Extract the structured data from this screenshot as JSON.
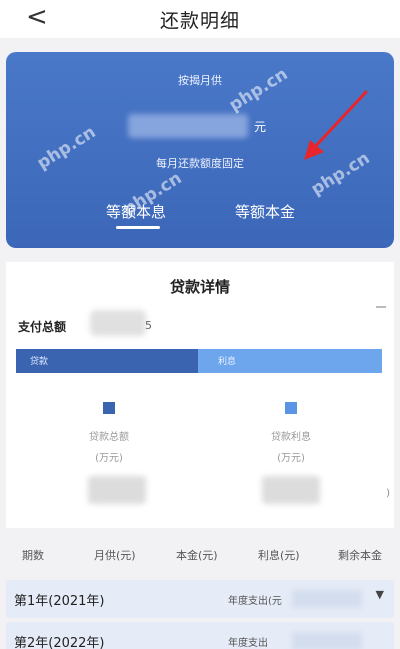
{
  "header": {
    "back_icon": "chevron-left-icon",
    "back_glyph": "<",
    "title": "还款明细"
  },
  "card": {
    "label": "按揭月供",
    "unit": "元",
    "fixed_note": "每月还款额度固定",
    "tabs": [
      {
        "label": "等额本息",
        "active": true
      },
      {
        "label": "等额本金",
        "active": false
      }
    ],
    "watermarks": [
      "php.cn",
      "php.cn",
      "php.cn",
      "php.cn"
    ],
    "accent_color": "#4272c4",
    "annotation_arrow_color": "#e8252a"
  },
  "details": {
    "title": "贷款详情",
    "total_label": "支付总额",
    "total_tail": "5",
    "bar": {
      "principal_label": "贷款",
      "interest_label": "利息",
      "principal_color": "#3a63b0",
      "interest_color": "#6ea6ee"
    },
    "legends": [
      {
        "line1": "贷款总额",
        "line2": "(万元)",
        "color": "#3a63b0"
      },
      {
        "line1": "贷款利息",
        "line2": "(万元)",
        "color": "#5a94e6"
      }
    ],
    "edge_glyph": ")"
  },
  "table": {
    "headers": [
      "期数",
      "月供(元)",
      "本金(元)",
      "利息(元)",
      "剩余本金"
    ],
    "rows": [
      {
        "year": "第1年(2021年)",
        "expense_label": "年度支出(元",
        "caret": "▼"
      },
      {
        "year": "第2年(2022年)",
        "expense_label": "年度支出",
        "caret": ""
      }
    ]
  }
}
